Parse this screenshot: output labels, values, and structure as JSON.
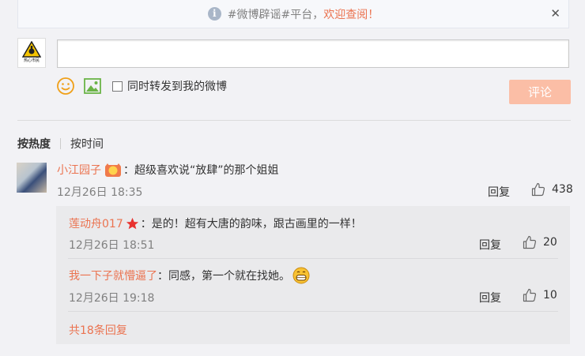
{
  "notice": {
    "text_prefix": "#微博辟谣#平台，",
    "link": "欢迎查阅！",
    "close": "✕"
  },
  "self_avatar": {
    "caption": "热心市民"
  },
  "composer": {
    "input_value": "",
    "forward_label": "同时转发到我的微博",
    "submit_label": "评论"
  },
  "sort": {
    "hot": "按热度",
    "time": "按时间"
  },
  "comment": {
    "user": "小江园子",
    "text": "：超级喜欢说“放肆”的那个姐姐",
    "time": "12月26日 18:35",
    "reply_label": "回复",
    "likes": "438"
  },
  "replies": [
    {
      "user": "莲动舟017",
      "text": "：是的！超有大唐的韵味，跟古画里的一样！",
      "time": "12月26日 18:51",
      "reply_label": "回复",
      "likes": "20"
    },
    {
      "user": "我一下子就懵逼了",
      "text": "：同感，第一个就在找她。",
      "time": "12月26日 19:18",
      "reply_label": "回复",
      "likes": "10"
    }
  ],
  "more_replies": "共18条回复",
  "colors": {
    "accent": "#eb7350",
    "submit_disabled": "#fbbea6",
    "background": "#f2f2f5"
  }
}
